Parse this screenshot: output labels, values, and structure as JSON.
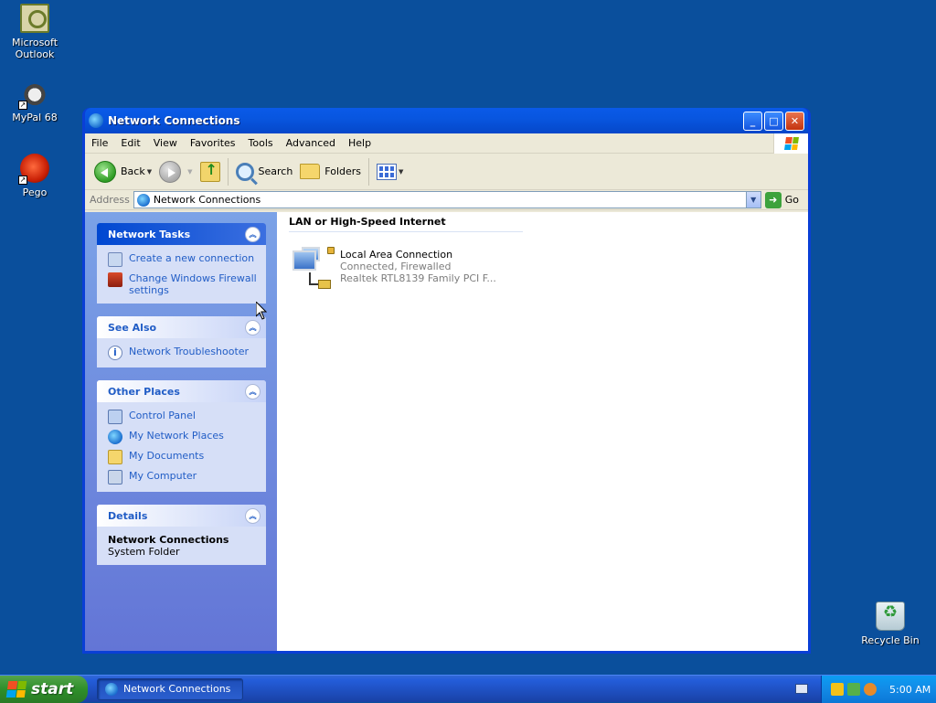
{
  "desktop": {
    "icons": [
      {
        "label": "Microsoft\nOutlook",
        "line1": "Microsoft",
        "line2": "Outlook"
      },
      {
        "label": "MyPal 68"
      },
      {
        "label": "Pego"
      },
      {
        "label": "Recycle Bin"
      }
    ]
  },
  "window": {
    "title": "Network Connections",
    "controls": {
      "minimize": "_",
      "maximize": "□",
      "close": "✕"
    },
    "menu": [
      "File",
      "Edit",
      "View",
      "Favorites",
      "Tools",
      "Advanced",
      "Help"
    ],
    "toolbar": {
      "back": "Back",
      "search": "Search",
      "folders": "Folders"
    },
    "address": {
      "label": "Address",
      "value": "Network Connections",
      "go": "Go"
    },
    "taskpane": {
      "network_tasks": {
        "title": "Network Tasks",
        "items": [
          "Create a new connection",
          "Change Windows Firewall settings"
        ]
      },
      "see_also": {
        "title": "See Also",
        "items": [
          "Network Troubleshooter"
        ]
      },
      "other_places": {
        "title": "Other Places",
        "items": [
          "Control Panel",
          "My Network Places",
          "My Documents",
          "My Computer"
        ]
      },
      "details": {
        "title": "Details",
        "name": "Network Connections",
        "type": "System Folder"
      }
    },
    "main": {
      "group_title": "LAN or High-Speed Internet",
      "connection": {
        "name": "Local Area Connection",
        "status": "Connected, Firewalled",
        "device": "Realtek RTL8139 Family PCI F..."
      }
    }
  },
  "taskbar": {
    "start_label": "start",
    "task_button": "Network Connections",
    "clock": "5:00 AM"
  },
  "colors": {
    "desktop": "#0a4f9c",
    "title_bar": "#0856e0",
    "task_link": "#215dc6",
    "taskpane": "#6f8fe0"
  }
}
